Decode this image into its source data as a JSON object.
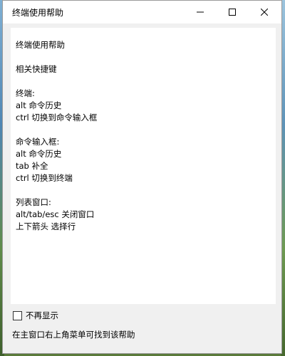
{
  "window": {
    "title": "终端使用帮助",
    "controls": {
      "minimize_icon": "minimize-icon",
      "maximize_icon": "maximize-icon",
      "close_icon": "close-icon"
    }
  },
  "help": {
    "heading": "终端使用帮助",
    "subheading": "相关快捷键",
    "sections": [
      {
        "title": "终端:",
        "items": [
          "alt 命令历史",
          "ctrl 切换到命令输入框"
        ]
      },
      {
        "title": "命令输入框:",
        "items": [
          "alt 命令历史",
          "tab 补全",
          "ctrl 切换到终端"
        ]
      },
      {
        "title": "列表窗口:",
        "items": [
          "alt/tab/esc 关闭窗口",
          "上下箭头 选择行"
        ]
      }
    ]
  },
  "footer": {
    "dont_show_again_label": "不再显示",
    "dont_show_again_checked": false,
    "note": "在主窗口右上角菜单可找到该帮助"
  }
}
